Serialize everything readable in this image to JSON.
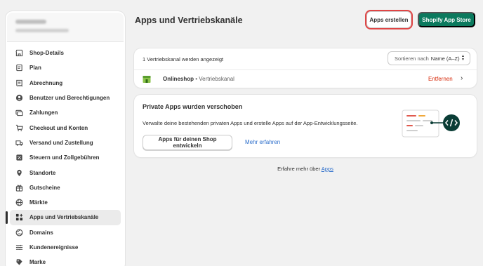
{
  "sidebar": {
    "items": [
      {
        "label": "Shop-Details",
        "icon": "store-icon"
      },
      {
        "label": "Plan",
        "icon": "plan-icon"
      },
      {
        "label": "Abrechnung",
        "icon": "billing-icon"
      },
      {
        "label": "Benutzer und Berechtigungen",
        "icon": "user-icon"
      },
      {
        "label": "Zahlungen",
        "icon": "payments-icon"
      },
      {
        "label": "Checkout und Konten",
        "icon": "cart-icon"
      },
      {
        "label": "Versand und Zustellung",
        "icon": "truck-icon"
      },
      {
        "label": "Steuern und Zollgebühren",
        "icon": "tax-icon"
      },
      {
        "label": "Standorte",
        "icon": "location-icon"
      },
      {
        "label": "Gutscheine",
        "icon": "gift-card-icon"
      },
      {
        "label": "Märkte",
        "icon": "globe-icon"
      },
      {
        "label": "Apps und Vertriebskanäle",
        "icon": "apps-icon",
        "active": true
      },
      {
        "label": "Domains",
        "icon": "domain-globe-icon"
      },
      {
        "label": "Kundenereignisse",
        "icon": "events-icon"
      },
      {
        "label": "Marke",
        "icon": "brand-icon"
      }
    ]
  },
  "header": {
    "title": "Apps und Vertriebskanäle",
    "create_button": "Apps erstellen",
    "store_button": "Shopify App Store"
  },
  "channels": {
    "count_text": "1 Vertriebskanal werden angezeigt",
    "sort_label": "Sortieren nach",
    "sort_value": "Name (A–Z)",
    "rows": [
      {
        "name": "Onlineshop",
        "separator": " • ",
        "type": "Vertriebskanal",
        "action": "Entfernen"
      }
    ]
  },
  "private_apps": {
    "title": "Private Apps wurden verschoben",
    "description": "Verwalte deine bestehenden privaten Apps und erstelle Apps auf der App-Entwicklungsseite.",
    "dev_button": "Apps für deinen Shop entwickeln",
    "learn_more": "Mehr erfahren"
  },
  "footer": {
    "text": "Erfahre mehr über",
    "link": "Apps"
  },
  "colors": {
    "primary": "#0b7a5e",
    "danger": "#d72c0d",
    "link": "#2c6ecb",
    "highlight": "#e04545"
  }
}
